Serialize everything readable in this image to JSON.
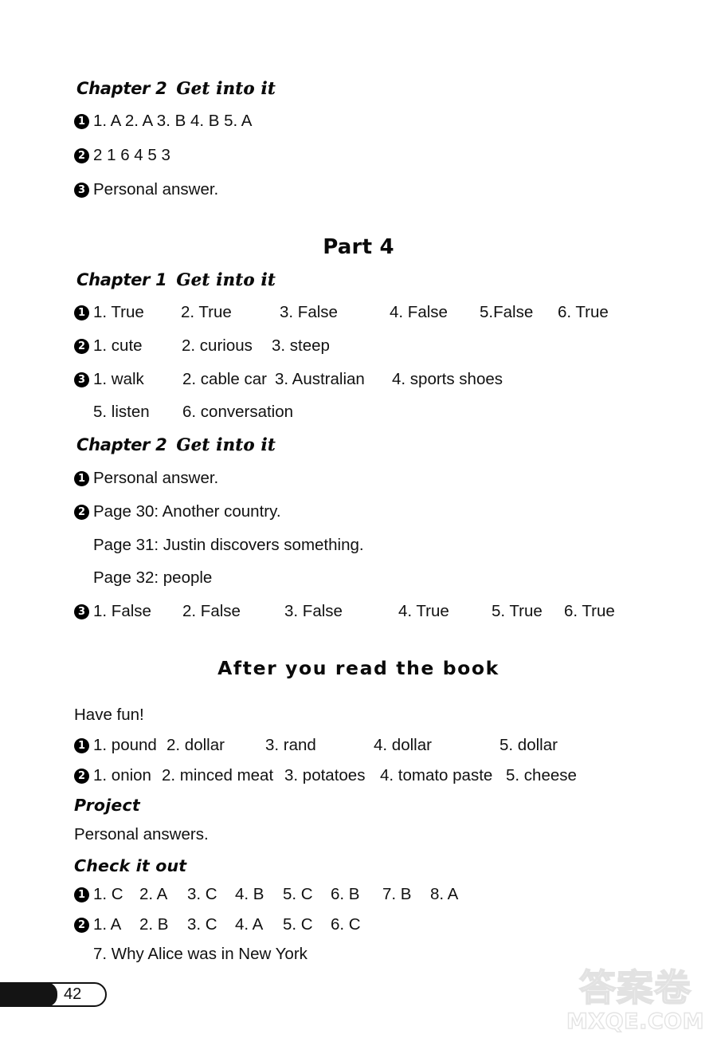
{
  "page": {
    "number": "42",
    "watermark_cn": "答案卷",
    "watermark_en": "MXQE.COM"
  },
  "top_section": {
    "chapter_label": "Chapter 2",
    "chapter_sub": "Get into it",
    "items": [
      {
        "marker": "1",
        "text": "1. A   2. A   3. B   4. B   5. A"
      },
      {
        "marker": "2",
        "text": "2  1  6  4  5  3"
      },
      {
        "marker": "3",
        "text": "Personal answer."
      }
    ]
  },
  "part4": {
    "title": "Part 4",
    "chapter1": {
      "chapter_label": "Chapter 1",
      "chapter_sub": "Get into it",
      "q1_marker": "1",
      "q1_cols": [
        "1. True",
        "2. True",
        "3. False",
        "4. False",
        "5.False",
        "6. True"
      ],
      "q2_marker": "2",
      "q2_cols": [
        "1. cute",
        "2. curious",
        "3. steep"
      ],
      "q3_marker": "3",
      "q3_cols": [
        "1. walk",
        "2. cable car",
        "3. Australian",
        "4. sports shoes"
      ],
      "q3_cols_line2": [
        "5. listen",
        "6. conversation"
      ]
    },
    "chapter2": {
      "chapter_label": "Chapter 2",
      "chapter_sub": "Get into it",
      "q1_marker": "1",
      "q1_text": "Personal answer.",
      "q2_marker": "2",
      "q2_line1": "Page 30: Another country.",
      "q2_line2": "Page 31: Justin discovers something.",
      "q2_line3": "Page 32: people",
      "q3_marker": "3",
      "q3_cols": [
        "1. False",
        "2. False",
        "3. False",
        "4. True",
        "5. True",
        "6. True"
      ]
    }
  },
  "after_you_read": {
    "title": "After you read the book",
    "have_fun_label": "Have fun!",
    "hf1_marker": "1",
    "hf1_cols": [
      "1. pound",
      "2. dollar",
      "3. rand",
      "4. dollar",
      "5. dollar"
    ],
    "hf2_marker": "2",
    "hf2_cols": [
      "1. onion",
      "2. minced meat",
      "3. potatoes",
      "4. tomato paste",
      "5. cheese"
    ],
    "project_label": "Project",
    "project_text": "Personal answers.",
    "check_label": "Check it out",
    "c1_marker": "1",
    "c1_cols": [
      "1. C",
      "2. A",
      "3. C",
      "4. B",
      "5. C",
      "6. B",
      "7. B",
      "8. A"
    ],
    "c2_marker": "2",
    "c2_cols": [
      "1. A",
      "2. B",
      "3. C",
      "4. A",
      "5. C",
      "6. C"
    ],
    "c2_line2": "7. Why Alice was in New York"
  }
}
